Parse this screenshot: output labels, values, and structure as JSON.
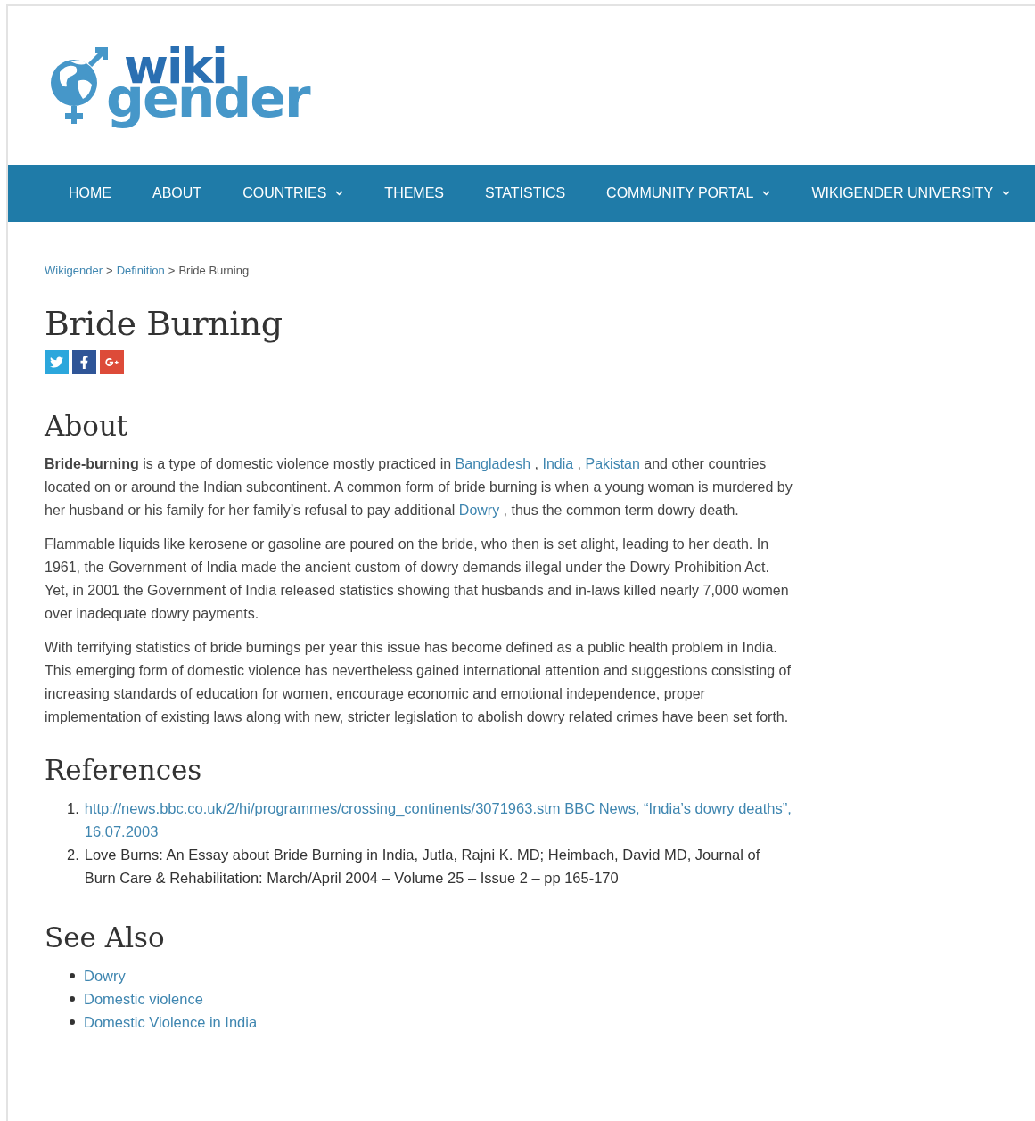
{
  "logo": {
    "top": "wiki",
    "bottom": "gender"
  },
  "nav": [
    {
      "label": "HOME",
      "dropdown": false
    },
    {
      "label": "ABOUT",
      "dropdown": false
    },
    {
      "label": "COUNTRIES",
      "dropdown": true
    },
    {
      "label": "THEMES",
      "dropdown": false
    },
    {
      "label": "STATISTICS",
      "dropdown": false
    },
    {
      "label": "COMMUNITY PORTAL",
      "dropdown": true
    },
    {
      "label": "WIKIGENDER UNIVERSITY",
      "dropdown": true
    }
  ],
  "breadcrumb": [
    {
      "label": "Wikigender",
      "link": true
    },
    {
      "label": ">",
      "link": false
    },
    {
      "label": "Definition",
      "link": true
    },
    {
      "label": ">",
      "link": false
    },
    {
      "label": "Bride Burning",
      "link": false
    }
  ],
  "title": "Bride Burning",
  "share": [
    {
      "kind": "twitter"
    },
    {
      "kind": "facebook"
    },
    {
      "kind": "googleplus"
    }
  ],
  "sections": [
    {
      "heading": "About",
      "paragraphs": [
        [
          {
            "kind": "bold",
            "text": "Bride-burning"
          },
          {
            "kind": "plain",
            "text": " is a type of domestic violence mostly practiced in "
          },
          {
            "kind": "link",
            "text": "Bangladesh"
          },
          {
            "kind": "plain",
            "text": " , "
          },
          {
            "kind": "link",
            "text": "India"
          },
          {
            "kind": "plain",
            "text": " , "
          },
          {
            "kind": "link",
            "text": "Pakistan"
          },
          {
            "kind": "plain",
            "text": " and other countries located on or around the Indian subcontinent. A common form of bride burning is when a young woman is murdered by her husband or his family for her family’s refusal to pay additional "
          },
          {
            "kind": "link",
            "text": "Dowry"
          },
          {
            "kind": "plain",
            "text": " , thus the common term dowry death."
          }
        ],
        [
          {
            "kind": "plain",
            "text": "Flammable liquids like kerosene or gasoline are poured on the bride, who then is set alight, leading to her death. In 1961, the Government of India made the ancient custom of dowry demands illegal under the Dowry Prohibition Act. Yet, in 2001 the Government of India released statistics showing that husbands and in-laws killed nearly 7,000 women over inadequate dowry payments."
          }
        ],
        [
          {
            "kind": "plain",
            "text": "With terrifying statistics of bride burnings per year this issue has become defined as a public health problem in India. This emerging form of domestic violence has nevertheless gained international attention and suggestions consisting of increasing standards of education for women, encourage economic and emotional independence, proper implementation of existing laws along with new, stricter legislation to abolish dowry related crimes have been set forth."
          }
        ]
      ]
    }
  ],
  "references": {
    "heading": "References",
    "items": [
      {
        "number": "1.",
        "text": "http://news.bbc.co.uk/2/hi/programmes/crossing_continents/3071963.stm BBC News, “India’s dowry deaths”, 16.07.2003",
        "link": true
      },
      {
        "number": "2.",
        "text": "Love Burns: An Essay about Bride Burning in India, Jutla, Rajni K. MD; Heimbach, David MD, Journal of Burn Care & Rehabilitation: March/April 2004 – Volume 25 – Issue 2 – pp 165-170",
        "link": false
      }
    ]
  },
  "see_also": {
    "heading": "See Also",
    "items": [
      "Dowry",
      "Domestic violence",
      "Domestic Violence in India"
    ]
  }
}
